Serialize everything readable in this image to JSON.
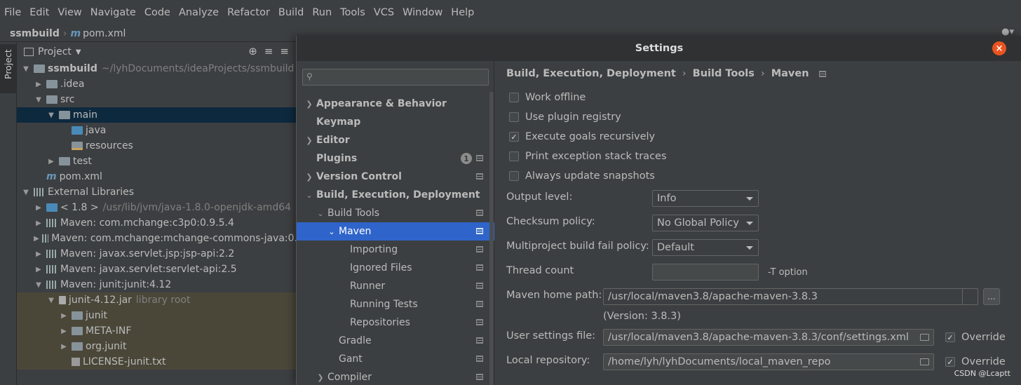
{
  "menu": [
    "File",
    "Edit",
    "View",
    "Navigate",
    "Code",
    "Analyze",
    "Refactor",
    "Build",
    "Run",
    "Tools",
    "VCS",
    "Window",
    "Help"
  ],
  "navbar": {
    "project": "ssmbuild",
    "file": "pom.xml",
    "m_glyph": "m"
  },
  "toolstrip": {
    "project_tab": "Project"
  },
  "project_panel": {
    "title": "Project",
    "tree": [
      {
        "label": "ssmbuild",
        "extra": "~/lyhDocuments/ideaProjects/ssmbuild"
      },
      {
        "label": ".idea"
      },
      {
        "label": "src"
      },
      {
        "label": "main"
      },
      {
        "label": "java"
      },
      {
        "label": "resources"
      },
      {
        "label": "test"
      },
      {
        "label": "pom.xml"
      },
      {
        "label": "External Libraries"
      },
      {
        "label": "< 1.8 >",
        "extra": "/usr/lib/jvm/java-1.8.0-openjdk-amd64"
      },
      {
        "label": "Maven: com.mchange:c3p0:0.9.5.4"
      },
      {
        "label": "Maven: com.mchange:mchange-commons-java:0."
      },
      {
        "label": "Maven: javax.servlet.jsp:jsp-api:2.2"
      },
      {
        "label": "Maven: javax.servlet:servlet-api:2.5"
      },
      {
        "label": "Maven: junit:junit:4.12"
      },
      {
        "label": "junit-4.12.jar",
        "extra": "library root"
      },
      {
        "label": "junit"
      },
      {
        "label": "META-INF"
      },
      {
        "label": "org.junit"
      },
      {
        "label": "LICENSE-junit.txt"
      }
    ]
  },
  "settings": {
    "title": "Settings",
    "close": "×",
    "nav": [
      {
        "label": "Appearance & Behavior"
      },
      {
        "label": "Keymap"
      },
      {
        "label": "Editor"
      },
      {
        "label": "Plugins",
        "badge": "1"
      },
      {
        "label": "Version Control"
      },
      {
        "label": "Build, Execution, Deployment"
      },
      {
        "label": "Build Tools"
      },
      {
        "label": "Maven"
      },
      {
        "label": "Importing"
      },
      {
        "label": "Ignored Files"
      },
      {
        "label": "Runner"
      },
      {
        "label": "Running Tests"
      },
      {
        "label": "Repositories"
      },
      {
        "label": "Gradle"
      },
      {
        "label": "Gant"
      },
      {
        "label": "Compiler"
      }
    ],
    "breadcrumb": [
      "Build, Execution, Deployment",
      "Build Tools",
      "Maven"
    ],
    "breadcrumb_sep": "›",
    "checkboxes": [
      {
        "label": "Work offline",
        "checked": false
      },
      {
        "label": "Use plugin registry",
        "checked": false
      },
      {
        "label": "Execute goals recursively",
        "checked": true
      },
      {
        "label": "Print exception stack traces",
        "checked": false
      },
      {
        "label": "Always update snapshots",
        "checked": false
      }
    ],
    "check_mark": "✓",
    "output_level": {
      "label": "Output level:",
      "value": "Info"
    },
    "checksum_policy": {
      "label": "Checksum policy:",
      "value": "No Global Policy"
    },
    "fail_policy": {
      "label": "Multiproject build fail policy:",
      "value": "Default"
    },
    "thread_count": {
      "label": "Thread count",
      "value": "",
      "hint": "-T option"
    },
    "maven_home": {
      "label": "Maven home path:",
      "value": "/usr/local/maven3.8/apache-maven-3.8.3",
      "version": "(Version: 3.8.3)",
      "browse": "..."
    },
    "user_settings": {
      "label": "User settings file:",
      "value": "/usr/local/maven3.8/apache-maven-3.8.3/conf/settings.xml",
      "override_label": "Override",
      "override": true
    },
    "local_repo": {
      "label": "Local repository:",
      "value": "/home/lyh/lyhDocuments/local_maven_repo",
      "override_label": "Override",
      "override": true
    }
  },
  "watermark": "CSDN @Lcaptt"
}
